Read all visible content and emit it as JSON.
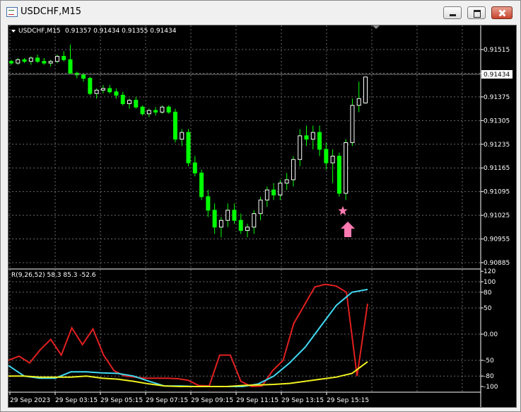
{
  "window": {
    "title": "USDCHF,M15"
  },
  "chart": {
    "header": {
      "symbol": "USDCHF,M15",
      "ohlc": "0.91357 0.91434 0.91355 0.91434"
    },
    "price_axis": {
      "ticks": [
        "0.91515",
        "0.91445",
        "0.91375",
        "0.91305",
        "0.91235",
        "0.91165",
        "0.91095",
        "0.91025",
        "0.90955",
        "0.90885"
      ],
      "current_price": "0.91434"
    },
    "time_axis": [
      "29 Sep 2023",
      "29 Sep 03:15",
      "29 Sep 05:15",
      "29 Sep 07:15",
      "29 Sep 09:15",
      "29 Sep 11:15",
      "29 Sep 13:15",
      "29 Sep 15:15"
    ],
    "indicator": {
      "label": "R(9,26,52) 58.3 85.3 -52.6",
      "ticks": [
        "120",
        "100",
        "80",
        "50",
        "0.00",
        "-50",
        "-80",
        "-100"
      ]
    },
    "colors": {
      "background": "#000000",
      "bull": "#ffffff",
      "bear": "#00ff00",
      "red_line": "#e02020",
      "cyan_line": "#40d8f0",
      "yellow_line": "#f0f020",
      "marker": "#ff7ab0"
    },
    "markers": {
      "star": "star-icon",
      "arrow": "up-arrow-icon"
    }
  },
  "chart_data": [
    {
      "type": "candlestick",
      "title": "USDCHF,M15",
      "ylim": [
        0.9086,
        0.9157
      ],
      "candles_ohlc": [
        [
          0.9148,
          0.91485,
          0.9147,
          0.91475
        ],
        [
          0.91475,
          0.9149,
          0.9147,
          0.91485
        ],
        [
          0.91485,
          0.9149,
          0.91475,
          0.9148
        ],
        [
          0.9148,
          0.91495,
          0.9147,
          0.9149
        ],
        [
          0.9149,
          0.915,
          0.91475,
          0.9148
        ],
        [
          0.9148,
          0.9149,
          0.9147,
          0.91475
        ],
        [
          0.91475,
          0.91485,
          0.91465,
          0.9148
        ],
        [
          0.9148,
          0.915,
          0.91475,
          0.91495
        ],
        [
          0.91495,
          0.9151,
          0.9148,
          0.91485
        ],
        [
          0.91485,
          0.9153,
          0.9145,
          0.91445
        ],
        [
          0.91445,
          0.9145,
          0.9143,
          0.9144
        ],
        [
          0.9144,
          0.91445,
          0.9142,
          0.9143
        ],
        [
          0.9143,
          0.91435,
          0.9138,
          0.91385
        ],
        [
          0.91385,
          0.914,
          0.9137,
          0.91395
        ],
        [
          0.91395,
          0.9141,
          0.91385,
          0.914
        ],
        [
          0.914,
          0.9141,
          0.91385,
          0.9139
        ],
        [
          0.9139,
          0.914,
          0.9137,
          0.9138
        ],
        [
          0.9138,
          0.9139,
          0.9135,
          0.91355
        ],
        [
          0.91355,
          0.9137,
          0.9134,
          0.91365
        ],
        [
          0.91365,
          0.91375,
          0.9134,
          0.91345
        ],
        [
          0.91345,
          0.9135,
          0.9132,
          0.91325
        ],
        [
          0.91325,
          0.9134,
          0.91315,
          0.91335
        ],
        [
          0.91335,
          0.91345,
          0.9132,
          0.9133
        ],
        [
          0.9133,
          0.9135,
          0.91325,
          0.91345
        ],
        [
          0.91345,
          0.9135,
          0.91325,
          0.9133
        ],
        [
          0.9133,
          0.9134,
          0.9124,
          0.9125
        ],
        [
          0.9125,
          0.9128,
          0.9123,
          0.9127
        ],
        [
          0.9127,
          0.9128,
          0.9117,
          0.9118
        ],
        [
          0.9118,
          0.912,
          0.9114,
          0.9115
        ],
        [
          0.9115,
          0.9116,
          0.9107,
          0.9108
        ],
        [
          0.9108,
          0.911,
          0.9102,
          0.9104
        ],
        [
          0.9104,
          0.9106,
          0.9097,
          0.9099
        ],
        [
          0.9099,
          0.9102,
          0.9096,
          0.9101
        ],
        [
          0.9101,
          0.9106,
          0.9099,
          0.9104
        ],
        [
          0.9104,
          0.9106,
          0.91,
          0.9101
        ],
        [
          0.9101,
          0.9103,
          0.9097,
          0.9098
        ],
        [
          0.9098,
          0.91,
          0.9096,
          0.9099
        ],
        [
          0.9099,
          0.9104,
          0.9097,
          0.9103
        ],
        [
          0.9103,
          0.9108,
          0.9101,
          0.9107
        ],
        [
          0.9107,
          0.9111,
          0.9105,
          0.911
        ],
        [
          0.911,
          0.9112,
          0.9107,
          0.91085
        ],
        [
          0.91085,
          0.9113,
          0.9107,
          0.9112
        ],
        [
          0.9112,
          0.9115,
          0.911,
          0.9113
        ],
        [
          0.9113,
          0.912,
          0.9111,
          0.9119
        ],
        [
          0.9119,
          0.9128,
          0.9117,
          0.9126
        ],
        [
          0.9126,
          0.9129,
          0.9123,
          0.9125
        ],
        [
          0.9125,
          0.9129,
          0.9122,
          0.9127
        ],
        [
          0.9127,
          0.9129,
          0.912,
          0.9122
        ],
        [
          0.9122,
          0.9124,
          0.9116,
          0.9118
        ],
        [
          0.9118,
          0.9122,
          0.9112,
          0.912
        ],
        [
          0.912,
          0.9121,
          0.9108,
          0.9109
        ],
        [
          0.9109,
          0.9125,
          0.9107,
          0.9124
        ],
        [
          0.9124,
          0.9137,
          0.9123,
          0.9135
        ],
        [
          0.9135,
          0.9142,
          0.9133,
          0.9137
        ],
        [
          0.91357,
          0.91434,
          0.91355,
          0.91434
        ]
      ]
    },
    {
      "type": "line",
      "title": "R(9,26,52) 58.3 85.3 -52.6",
      "ylim": [
        -100,
        120
      ],
      "series": [
        {
          "color": "#e02020",
          "values": [
            -50,
            -42,
            -55,
            -30,
            -10,
            -40,
            12,
            -20,
            10,
            -40,
            -70,
            -80,
            -82,
            -84,
            -84,
            -84,
            -85,
            -88,
            -98,
            -99,
            -40,
            -40,
            -90,
            -100,
            -99,
            -70,
            -50,
            20,
            55,
            90,
            95,
            92,
            80,
            -80,
            58.3
          ]
        },
        {
          "color": "#40d8f0",
          "values": [
            -60,
            -80,
            -84,
            -84,
            -72,
            -72,
            -74,
            -75,
            -80,
            -90,
            -99,
            -99,
            -100,
            -100,
            -100,
            -100,
            -95,
            -80,
            -55,
            -25,
            15,
            55,
            80,
            85.3
          ]
        },
        {
          "color": "#f0f020",
          "values": [
            -80,
            -80,
            -82,
            -82,
            -82,
            -80,
            -84,
            -86,
            -90,
            -95,
            -99,
            -100,
            -100,
            -100,
            -100,
            -98,
            -97,
            -96,
            -94,
            -90,
            -86,
            -82,
            -75,
            -52.6
          ]
        }
      ]
    }
  ]
}
